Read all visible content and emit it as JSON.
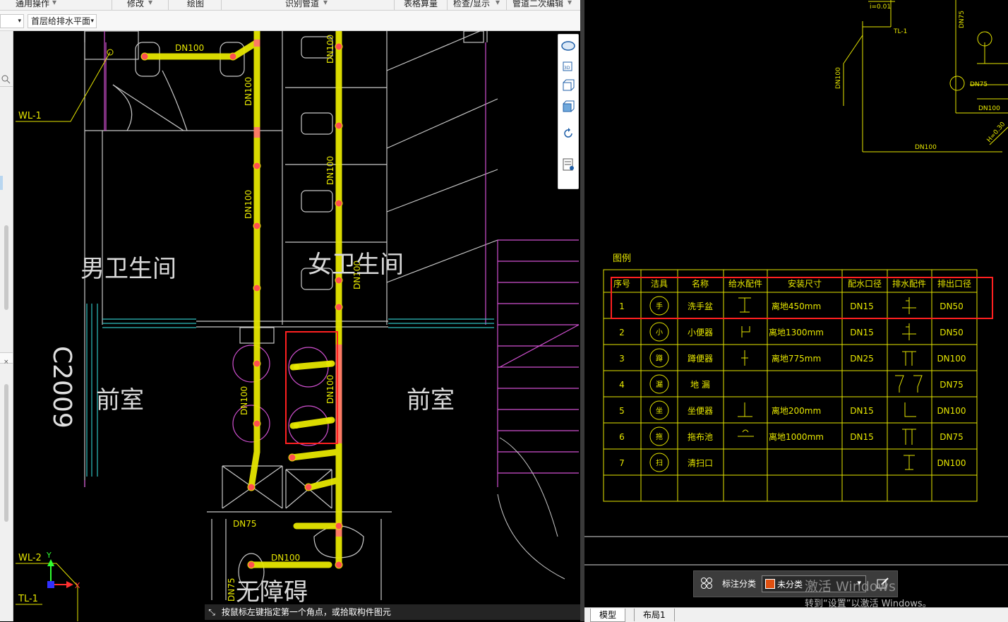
{
  "menu": {
    "items": [
      "通用操作",
      "修改",
      "绘图",
      "识别管道",
      "表格算量",
      "检查/显示",
      "管道二次编辑"
    ]
  },
  "toolbar": {
    "floor_select": "首层给排水平面"
  },
  "plan": {
    "room_male": "男卫生间",
    "room_female": "女卫生间",
    "room_front_left": "前室",
    "room_front_right": "前室",
    "room_accessible": "无障碍",
    "door_code": "C2009",
    "pipe_labels": [
      "DN100",
      "DN100",
      "DN100",
      "DN100",
      "DN100",
      "DN100",
      "DN100",
      "DN75",
      "DN75",
      "DN100"
    ],
    "riser_labels": [
      "WL-1",
      "WL-2",
      "TL-1"
    ],
    "axis_x": "X",
    "axis_y": "Y"
  },
  "status": {
    "hint": "按鼠标左键指定第一个角点，或拾取构件图元"
  },
  "legend": {
    "title": "图例",
    "headers": [
      "序号",
      "洁具",
      "名称",
      "给水配件",
      "安装尺寸",
      "配水口径",
      "排水配件",
      "排出口径"
    ],
    "rows": [
      {
        "no": "1",
        "sym": "手",
        "name": "洗手盆",
        "size": "离地450mm",
        "supply_dn": "DN15",
        "drain_dn": "DN50"
      },
      {
        "no": "2",
        "sym": "小",
        "name": "小便器",
        "size": "离地1300mm",
        "supply_dn": "DN15",
        "drain_dn": "DN50"
      },
      {
        "no": "3",
        "sym": "蹲",
        "name": "蹲便器",
        "size": "离地775mm",
        "supply_dn": "DN25",
        "drain_dn": "DN100"
      },
      {
        "no": "4",
        "sym": "漏",
        "name": "地 漏",
        "size": "",
        "supply_dn": "",
        "drain_dn": "DN75"
      },
      {
        "no": "5",
        "sym": "坐",
        "name": "坐便器",
        "size": "离地200mm",
        "supply_dn": "DN15",
        "drain_dn": "DN100"
      },
      {
        "no": "6",
        "sym": "拖",
        "name": "拖布池",
        "size": "离地1000mm",
        "supply_dn": "DN15",
        "drain_dn": "DN75"
      },
      {
        "no": "7",
        "sym": "扫",
        "name": "清扫口",
        "size": "",
        "supply_dn": "",
        "drain_dn": "DN100"
      }
    ]
  },
  "system_diagram": {
    "labels": [
      "TL-1",
      "DN100",
      "DN75",
      "DN100",
      "DN100",
      "H=0.30",
      "DN75",
      "i=0.01"
    ]
  },
  "bottom_tabs": [
    "模型",
    "布局1"
  ],
  "annotation": {
    "label": "标注分类",
    "value": "未分类"
  },
  "watermark": {
    "line1": "激活 Windows",
    "line2": "转到“设置”以激活 Windows。"
  },
  "colors": {
    "pipe": "#e6e600",
    "highlight": "#ff3030",
    "wall": "#c8c8c8",
    "magenta": "#d050d0",
    "cyan": "#30c0c0",
    "cad_yellow": "#ffff00"
  }
}
